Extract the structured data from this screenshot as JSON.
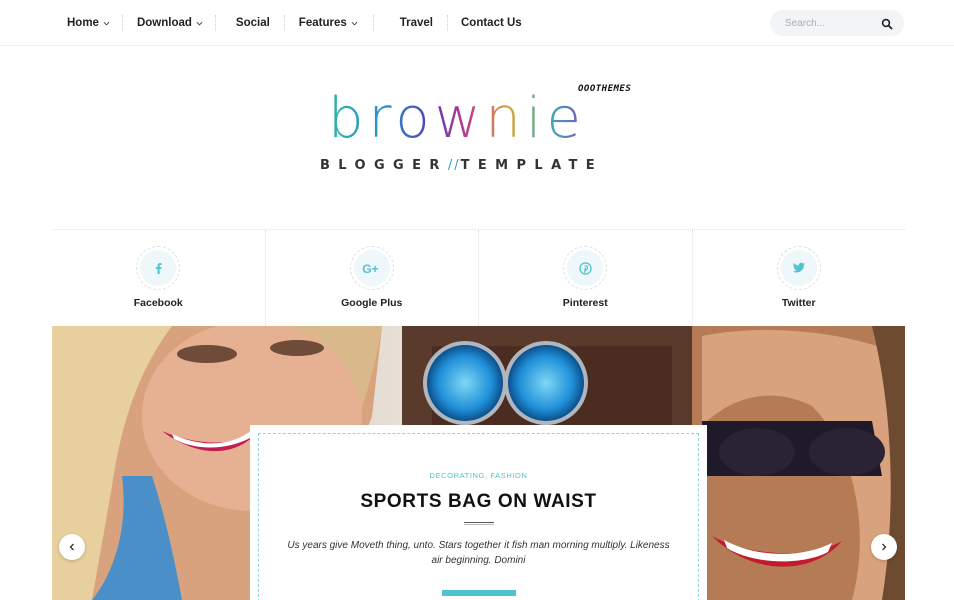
{
  "nav": {
    "items": [
      {
        "label": "Home",
        "dropdown": true
      },
      {
        "label": "Download",
        "dropdown": true
      },
      {
        "label": "Social",
        "dropdown": false
      },
      {
        "label": "Features",
        "dropdown": true
      },
      {
        "label": "Travel",
        "dropdown": false
      },
      {
        "label": "Contact Us",
        "dropdown": false
      }
    ],
    "search_placeholder": "Search..."
  },
  "logo": {
    "badge": "OOOTHEMES",
    "word": "brownie",
    "sub_left": "BLOGGER",
    "sub_right": "TEMPLATE"
  },
  "social": [
    {
      "label": "Facebook",
      "icon": "facebook-icon"
    },
    {
      "label": "Google Plus",
      "icon": "google-plus-icon"
    },
    {
      "label": "Pinterest",
      "icon": "pinterest-icon"
    },
    {
      "label": "Twitter",
      "icon": "twitter-icon"
    }
  ],
  "slide": {
    "categories": "DECORATING, FASHION",
    "title": "SPORTS BAG ON WAIST",
    "excerpt": "Us years give Moveth thing, unto. Stars together it fish man morning multiply. Likeness air beginning. Domini"
  },
  "colors": {
    "accent": "#4fc3cf",
    "icon_bg": "#eef8fa",
    "text": "#222222"
  }
}
